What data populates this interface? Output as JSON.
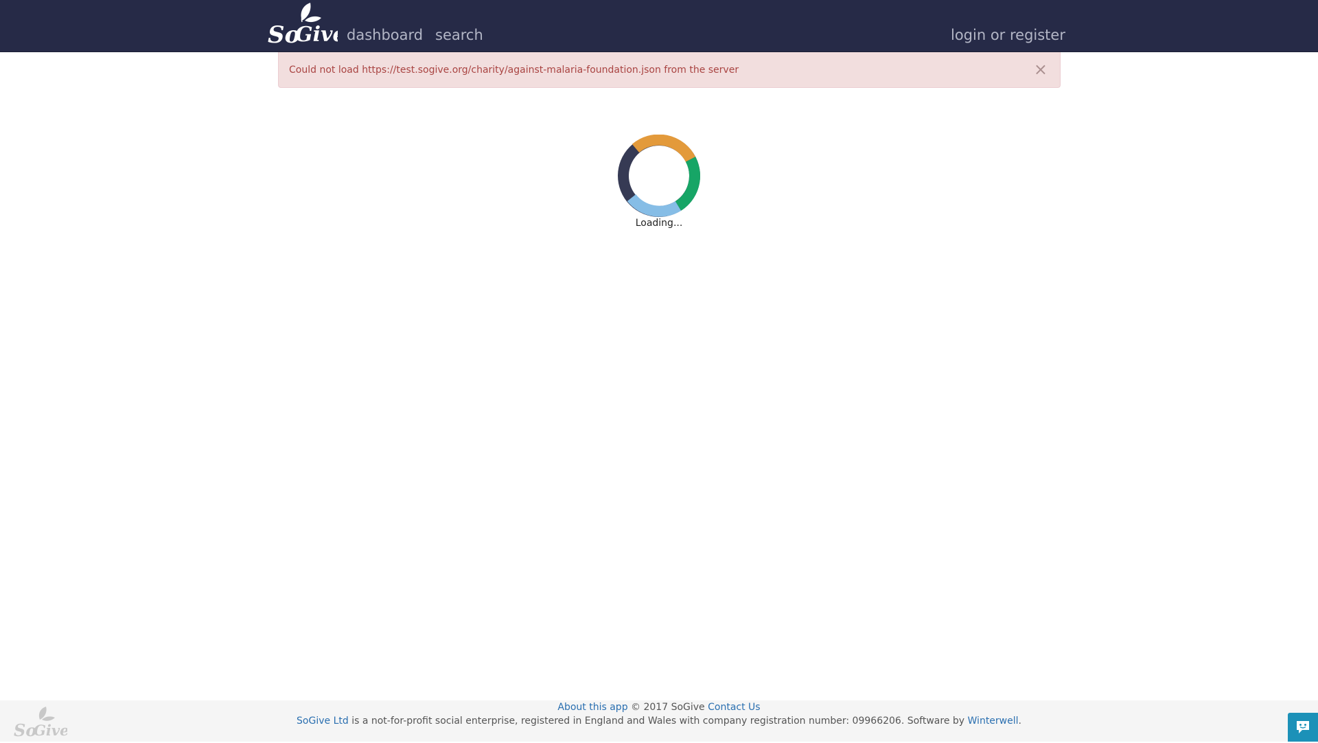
{
  "header": {
    "logo_alt": "SoGive",
    "nav": {
      "dashboard": "dashboard",
      "search": "search",
      "login": "login or register"
    }
  },
  "alert": {
    "message": "Could not load https://test.sogive.org/charity/against-malaria-foundation.json from the server",
    "close": "×"
  },
  "loader": {
    "text": "Loading...",
    "colors": [
      "#e39a3b",
      "#17a566",
      "#86bde6",
      "#363a54"
    ]
  },
  "footer": {
    "about_link": "About this app",
    "copyright": " © 2017 SoGive ",
    "contact_link": "Contact Us",
    "company_link": "SoGive Ltd",
    "description": " is a not-for-profit social enterprise, registered in England and Wales with company registration number: 09966206. Software by ",
    "winterwell_link": "Winterwell",
    "end": "."
  },
  "chat": {
    "icon": "chat-bubble-icon",
    "color": "#1c91b8"
  }
}
